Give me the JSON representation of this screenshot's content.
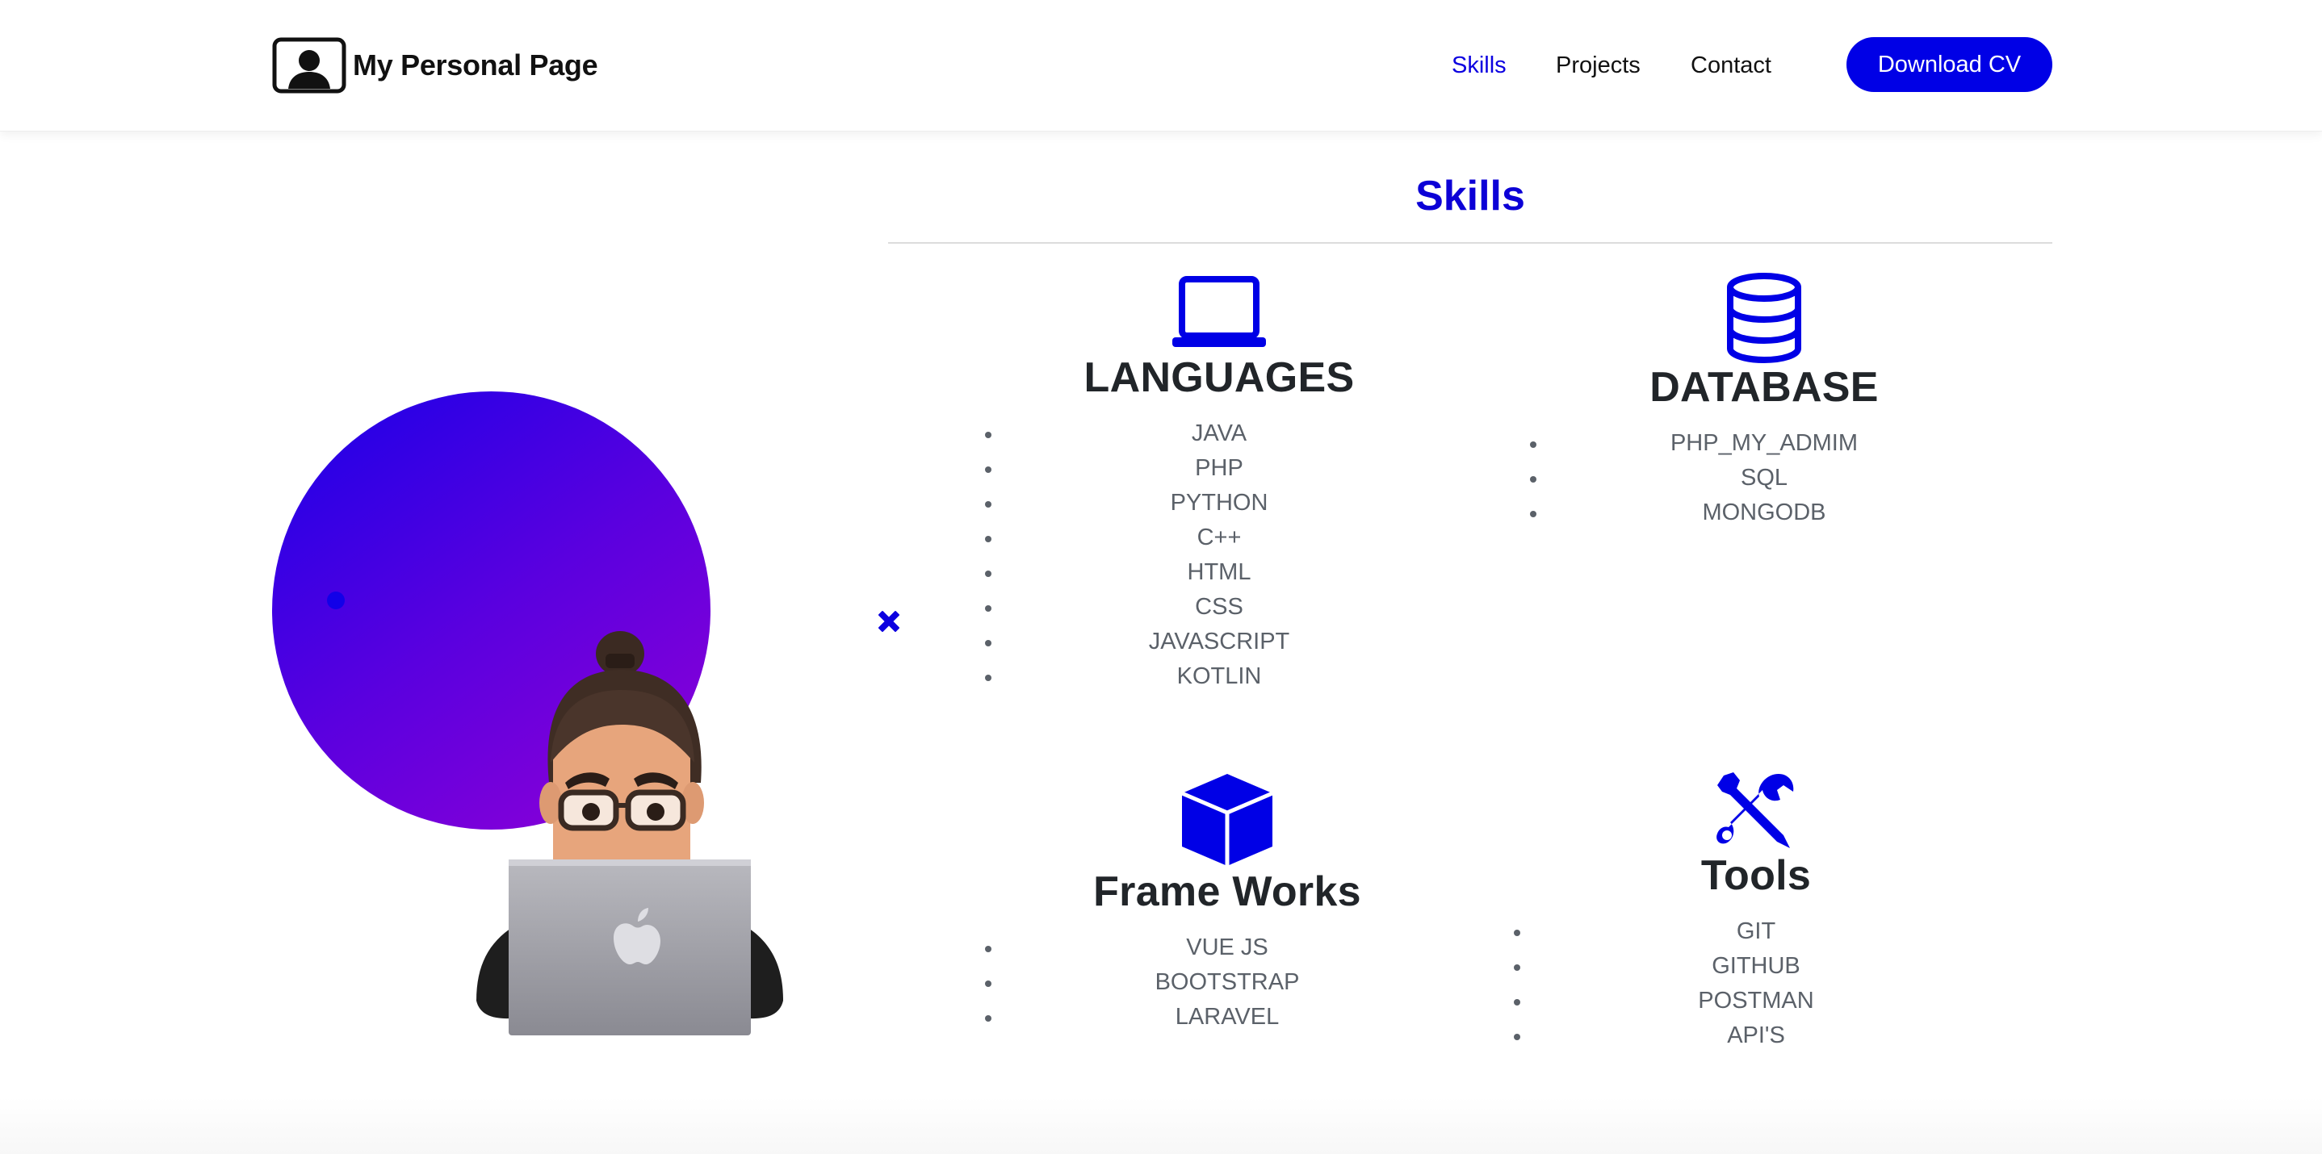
{
  "header": {
    "brand": "My Personal Page",
    "nav": [
      {
        "label": "Skills",
        "active": true
      },
      {
        "label": "Projects",
        "active": false
      },
      {
        "label": "Contact",
        "active": false
      }
    ],
    "cta": "Download CV"
  },
  "skills": {
    "title": "Skills",
    "languages": {
      "icon": "laptop-icon",
      "title": "LANGUAGES",
      "items": [
        "JAVA",
        "PHP",
        "PYTHON",
        "C++",
        "HTML",
        "CSS",
        "JAVASCRIPT",
        "KOTLIN"
      ]
    },
    "database": {
      "icon": "database-icon",
      "title": "DATABASE",
      "items": [
        "PHP_MY_ADMIM",
        "SQL",
        "MONGODB"
      ]
    },
    "frameworks": {
      "icon": "cube-icon",
      "title": "Frame Works",
      "items": [
        "VUE JS",
        "BOOTSTRAP",
        "LARAVEL"
      ]
    },
    "tools": {
      "icon": "tools-icon",
      "title": "Tools",
      "items": [
        "GIT",
        "GITHUB",
        "POSTMAN",
        "API'S"
      ]
    }
  },
  "colors": {
    "accent": "#0000e6",
    "title_blue": "#0c00d6",
    "gradient_start": "#1a00e8",
    "gradient_end": "#9200d6"
  }
}
